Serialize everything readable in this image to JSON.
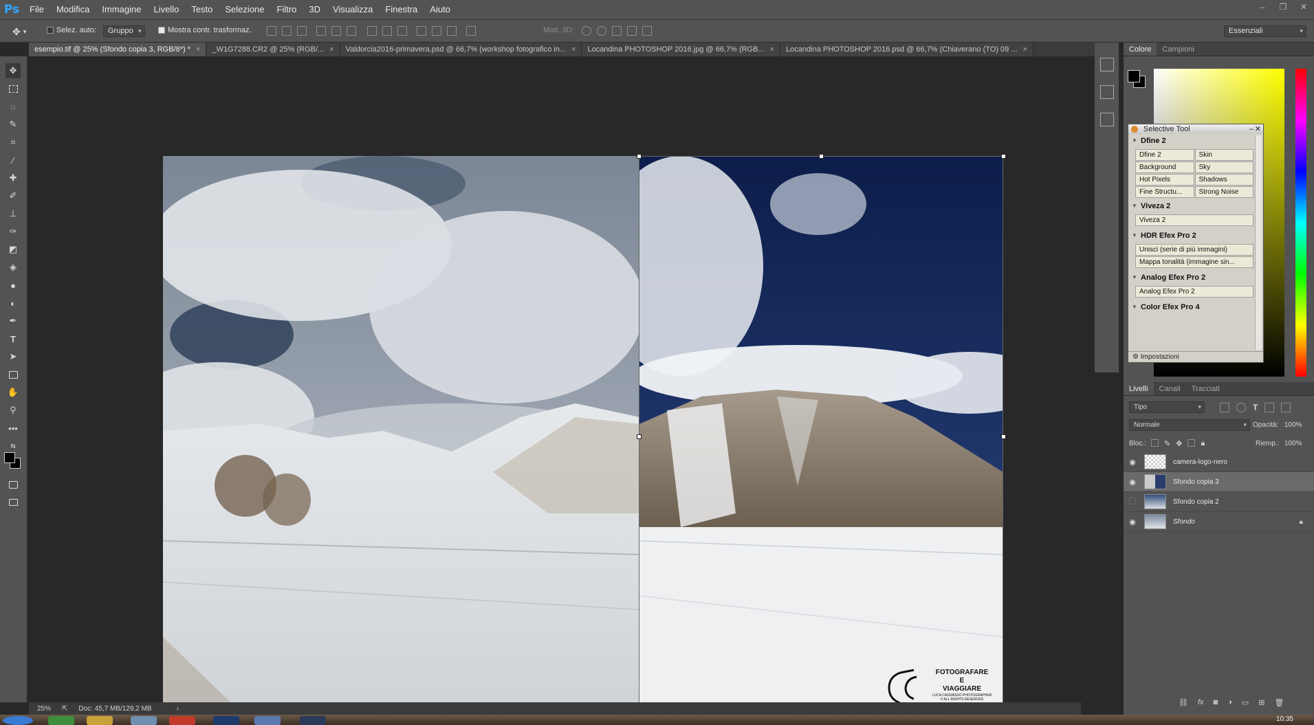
{
  "app": {
    "logo": "Ps"
  },
  "menu": [
    "File",
    "Modifica",
    "Immagine",
    "Livello",
    "Testo",
    "Selezione",
    "Filtro",
    "3D",
    "Visualizza",
    "Finestra",
    "Aiuto"
  ],
  "options": {
    "auto_select_label": "Selez. auto:",
    "auto_select_mode": "Gruppo",
    "show_transform_label": "Mostra contr. trasformaz.",
    "mode_3d_label": "Mod. 3D:",
    "workspace": "Essenziali"
  },
  "tabs": [
    {
      "label": "esempio.tif @ 25% (Sfondo copia 3, RGB/8*) *",
      "active": true
    },
    {
      "label": "_W1G7288.CR2 @ 25% (RGB/...",
      "active": false
    },
    {
      "label": "Valdorcia2016-primavera.psd @ 66,7% (workshop fotografico in...",
      "active": false
    },
    {
      "label": "Locandina PHOTOSHOP 2016.jpg @ 66,7% (RGB...",
      "active": false
    },
    {
      "label": "Locandina PHOTOSHOP 2016.psd @ 66,7% (Chiaverano (TO) 09 ...",
      "active": false
    }
  ],
  "watermark": {
    "line1": "FOTOGRAFARE",
    "line2": "E",
    "line3": "VIAGGIARE",
    "line4": "LUCA CAGNASSO PHOTOGRAPHER",
    "line5": "© ALL RIGHTS RESERVED"
  },
  "status": {
    "zoom": "25%",
    "doc": "Doc: 45,7 MB/129,2 MB"
  },
  "color_panel": {
    "tabs": [
      "Colore",
      "Campioni"
    ]
  },
  "selective_tool": {
    "title": "Selective Tool",
    "sections": [
      {
        "name": "Dfine 2",
        "buttons": [
          "Dfine 2",
          "Skin",
          "Background",
          "Sky",
          "Hot Pixels",
          "Shadows",
          "Fine Structu...",
          "Strong Noise"
        ]
      },
      {
        "name": "Viveza 2",
        "buttons": [
          "Viveza 2"
        ]
      },
      {
        "name": "HDR Efex Pro 2",
        "buttons": [
          "Unisci (serie di più immagini)",
          "Mappa tonalità (immagine sin..."
        ]
      },
      {
        "name": "Analog Efex Pro 2",
        "buttons": [
          "Analog Efex Pro 2"
        ]
      },
      {
        "name": "Color Efex Pro 4",
        "buttons": []
      }
    ],
    "settings": "Impostazioni"
  },
  "layers_panel": {
    "tabs": [
      "Livelli",
      "Canali",
      "Tracciati"
    ],
    "filter": "Tipo",
    "blend_mode": "Normale",
    "opacity_label": "Opacità:",
    "opacity": "100%",
    "lock_label": "Bloc.:",
    "fill_label": "Riemp.:",
    "fill": "100%",
    "layers": [
      {
        "name": "camera-logo-nero",
        "visible": true,
        "selected": false
      },
      {
        "name": "Sfondo copia 3",
        "visible": true,
        "selected": true
      },
      {
        "name": "Sfondo copia 2",
        "visible": false,
        "selected": false
      },
      {
        "name": "Sfondo",
        "visible": true,
        "selected": false,
        "locked": true
      }
    ]
  },
  "clock": "10:35"
}
